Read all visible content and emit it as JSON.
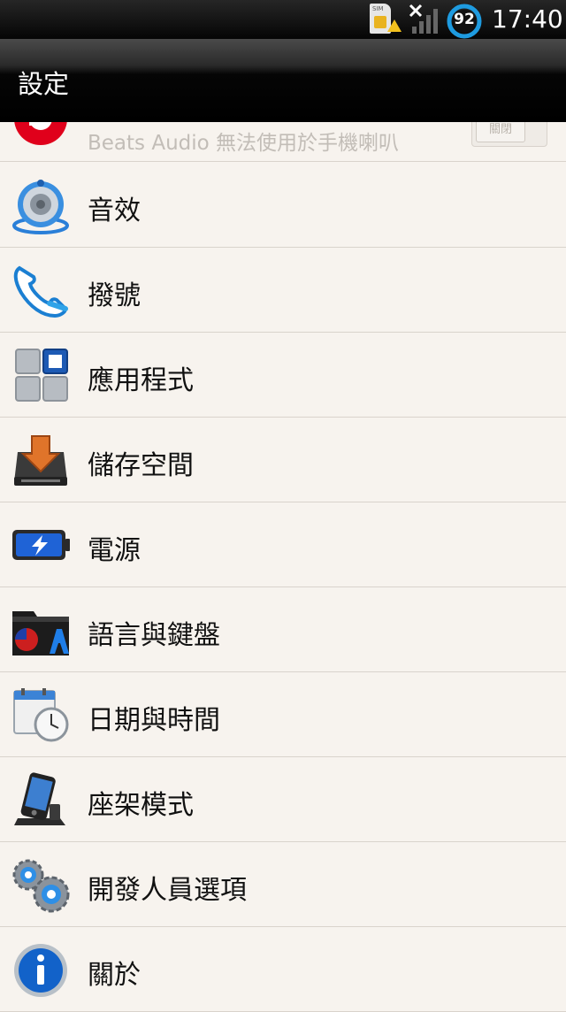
{
  "status_bar": {
    "sim_label": "SIM",
    "battery_level": "92",
    "time": "17:40",
    "icons": [
      "sim-warning-icon",
      "no-signal-icon",
      "battery-icon"
    ]
  },
  "header": {
    "title": "設定"
  },
  "beats": {
    "description": "Beats Audio 無法使用於手機喇叭",
    "toggle_label": "關閉"
  },
  "settings_items": [
    {
      "label": "音效",
      "icon": "speaker-icon"
    },
    {
      "label": "撥號",
      "icon": "phone-icon"
    },
    {
      "label": "應用程式",
      "icon": "apps-grid-icon"
    },
    {
      "label": "儲存空間",
      "icon": "storage-icon"
    },
    {
      "label": "電源",
      "icon": "battery-power-icon"
    },
    {
      "label": "語言與鍵盤",
      "icon": "language-keyboard-icon"
    },
    {
      "label": "日期與時間",
      "icon": "calendar-clock-icon"
    },
    {
      "label": "座架模式",
      "icon": "dock-icon"
    },
    {
      "label": "開發人員選項",
      "icon": "gears-icon"
    },
    {
      "label": "關於",
      "icon": "info-icon"
    }
  ]
}
